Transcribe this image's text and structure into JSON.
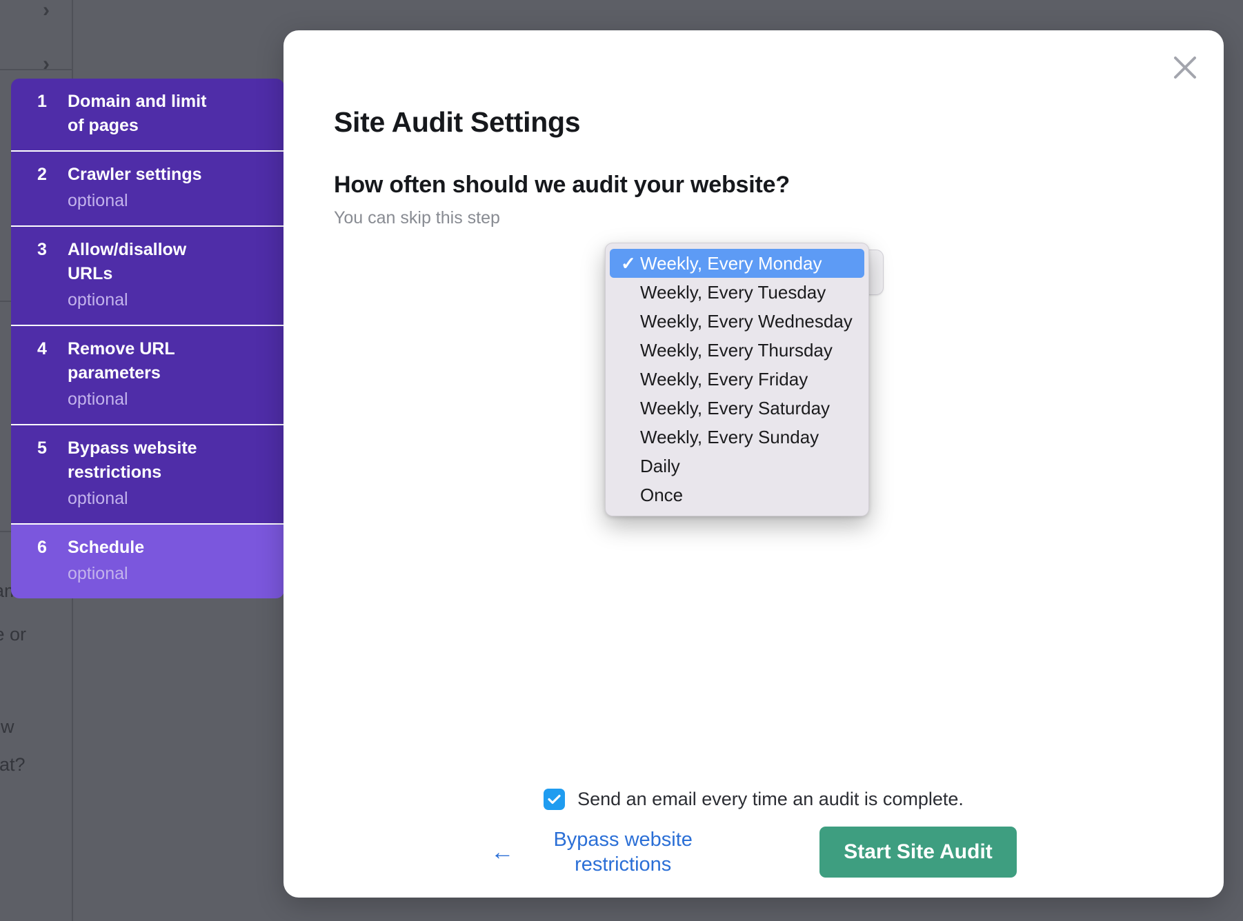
{
  "background": {
    "chevrons": [
      "chevron-right",
      "chevron-right"
    ],
    "text_fragments": [
      "ram",
      "se or",
      "ew",
      "nat?"
    ]
  },
  "stepper": {
    "steps": [
      {
        "num": "1",
        "title": "Domain and limit of pages",
        "optional": "",
        "active": false
      },
      {
        "num": "2",
        "title": "Crawler settings",
        "optional": "optional",
        "active": false
      },
      {
        "num": "3",
        "title": "Allow/disallow URLs",
        "optional": "optional",
        "active": false
      },
      {
        "num": "4",
        "title": "Remove URL parameters",
        "optional": "optional",
        "active": false
      },
      {
        "num": "5",
        "title": "Bypass website restrictions",
        "optional": "optional",
        "active": false
      },
      {
        "num": "6",
        "title": "Schedule",
        "optional": "optional",
        "active": true
      }
    ]
  },
  "modal": {
    "title": "Site Audit Settings",
    "close_icon": "close-icon",
    "question": "How often should we audit your website?",
    "subnote": "You can skip this step",
    "schedule_select": {
      "value": "Weekly, Every Monday",
      "options": [
        "Weekly, Every Monday",
        "Weekly, Every Tuesday",
        "Weekly, Every Wednesday",
        "Weekly, Every Thursday",
        "Weekly, Every Friday",
        "Weekly, Every Saturday",
        "Weekly, Every Sunday",
        "Daily",
        "Once"
      ],
      "selected_index": 0,
      "check_glyph": "✓"
    },
    "email_checkbox": {
      "label": "Send an email every time an audit is complete.",
      "checked": true
    },
    "footer": {
      "back_arrow": "←",
      "back_label": "Bypass website restrictions",
      "start_label": "Start Site Audit"
    }
  },
  "colors": {
    "backdrop": "#5d5f66",
    "step_inactive": "#4f2da8",
    "step_active": "#7b57dd",
    "accent_blue": "#2b6fd6",
    "highlight_blue": "#5d9bf5",
    "checkbox_blue": "#1f9cf0",
    "start_green": "#3e9e80"
  }
}
